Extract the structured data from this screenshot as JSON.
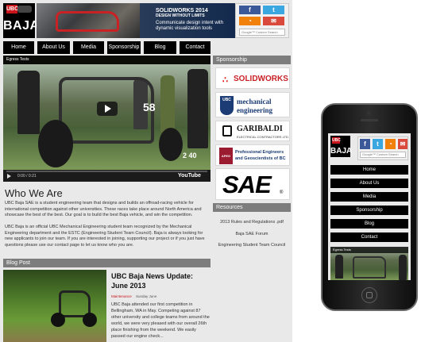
{
  "site": {
    "logo_top": "UBC",
    "logo_text": "BAJA",
    "banner": {
      "title": "SOLIDWORKS 2014",
      "subtitle": "DESIGN WITHOUT LIMITS",
      "tagline": "Communicate design intent with dynamic visualization tools"
    },
    "social": {
      "facebook": "f",
      "twitter": "t",
      "rss": "◔",
      "email": "✉"
    },
    "search_placeholder": "Google™ Custom Search",
    "nav": [
      "Home",
      "About Us",
      "Media",
      "Sponsorship",
      "Blog",
      "Contact"
    ],
    "video": {
      "title": "Egress Tests",
      "time": "0:00 / 0:21",
      "progress": 0.0,
      "brand": "YouTube",
      "car_number": "58",
      "overlay_number": "2 40"
    },
    "who": {
      "heading": "Who We Are",
      "para1": "UBC Baja SAE is a student engineering team that designs and builds an offroad-racing vehicle for international competition against other universities. These races take place around North America and showcase the best of the best. Our goal is to build the best Baja vehicle, and win the competition.",
      "para2": "UBC Baja is an official UBC Mechanical Engineering student team recognized by the Mechanical Engineering department and the ESTC (Engineering Student Team Council). Baja is always looking for new applicants to join our team. If you are interested in joining, supporting our project or if you just have questions please use our contact page to let us know who you are."
    },
    "blog": {
      "heading": "Blog Post",
      "title": "UBC Baja News Update: June 2013",
      "category": "Maintenance",
      "date": "Sunday June",
      "excerpt": "UBC Baja attended our first competition in Bellingham, WA in May. Competing against 87 other university and college teams from around the world, we were very pleased with our overall 26th place finishing from the weekend. We easily passed our engine check..."
    },
    "sponsorship": {
      "heading": "Sponsorship",
      "sponsors": {
        "solidworks": "SOLIDWORKS",
        "ubc_crest": "UBC",
        "ubc_line1": "mechanical",
        "ubc_line2": "engineering",
        "garibaldi": "GARIBALDI",
        "garibaldi_sub": "ELECTRICAL CONTRACTORS LTD.",
        "apeg_mark": "APEG",
        "apeg_line1": "Professional Engineers",
        "apeg_line2": "and Geoscientists of BC",
        "sae": "SAE"
      }
    },
    "resources": {
      "heading": "Resources",
      "links": [
        "2013 Rules and Regulations .pdf",
        "Baja SAE Forum",
        "Engineering Student Team Council"
      ]
    }
  },
  "mobile": {
    "logo_top": "UBC",
    "logo_text": "BAJA",
    "search_placeholder": "Google™ Custom Search",
    "nav": [
      "Home",
      "About Us",
      "Media",
      "Sponsorship",
      "Blog",
      "Contact"
    ],
    "video_title": "Egress Tests"
  },
  "colors": {
    "nav_bg": "#000000",
    "brand_red": "#c9151b",
    "facebook": "#3b5998",
    "twitter": "#3aa7e0",
    "rss": "#f2810c",
    "email": "#d9493c",
    "panel_head": "#7d7d7d",
    "maintenance_tag": "#c9151b"
  }
}
